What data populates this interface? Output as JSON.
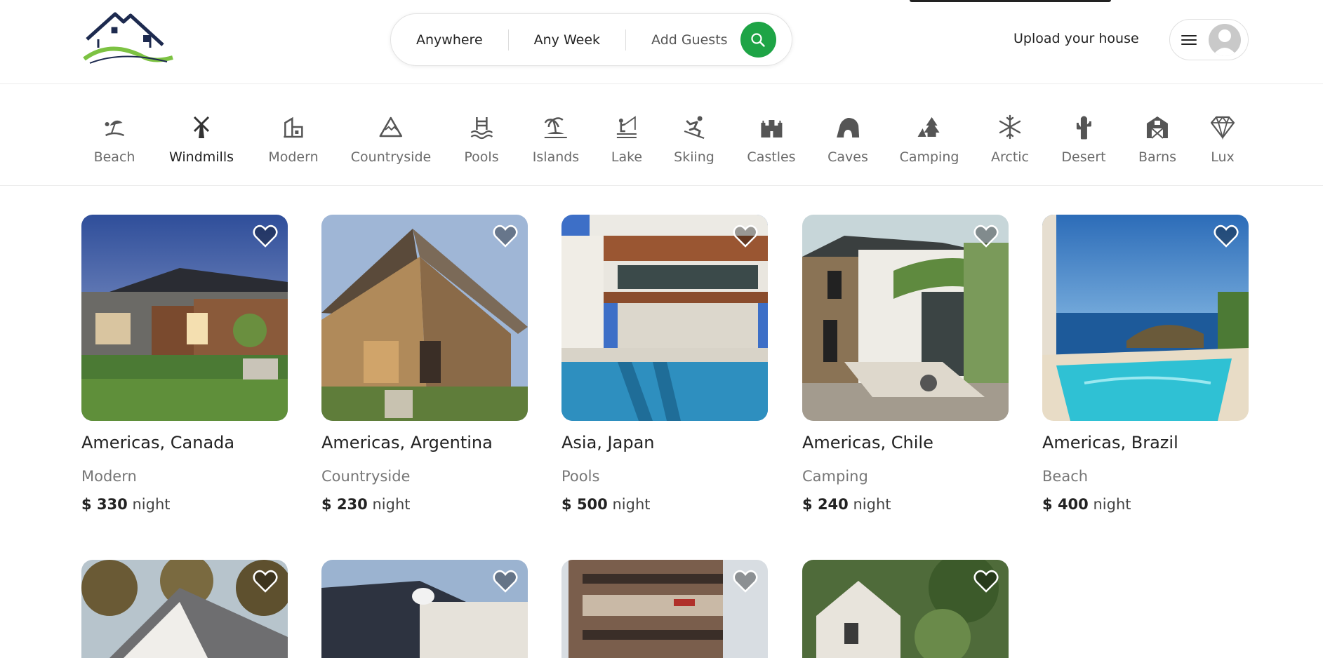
{
  "header": {
    "logo_icon": "house-logo-icon",
    "search": {
      "where": "Anywhere",
      "when": "Any Week",
      "guests": "Add Guests",
      "button_icon": "search-icon"
    },
    "upload_label": "Upload your house",
    "menu_icon": "menu-icon",
    "avatar_icon": "avatar-icon"
  },
  "categories": [
    {
      "label": "Beach",
      "icon": "beach-icon"
    },
    {
      "label": "Windmills",
      "icon": "windmill-icon"
    },
    {
      "label": "Modern",
      "icon": "modern-icon"
    },
    {
      "label": "Countryside",
      "icon": "mountain-icon"
    },
    {
      "label": "Pools",
      "icon": "pool-icon"
    },
    {
      "label": "Islands",
      "icon": "island-icon"
    },
    {
      "label": "Lake",
      "icon": "lake-icon"
    },
    {
      "label": "Skiing",
      "icon": "skiing-icon"
    },
    {
      "label": "Castles",
      "icon": "castle-icon"
    },
    {
      "label": "Caves",
      "icon": "cave-icon"
    },
    {
      "label": "Camping",
      "icon": "camping-icon"
    },
    {
      "label": "Arctic",
      "icon": "snowflake-icon"
    },
    {
      "label": "Desert",
      "icon": "cactus-icon"
    },
    {
      "label": "Barns",
      "icon": "barn-icon"
    },
    {
      "label": "Lux",
      "icon": "diamond-icon"
    }
  ],
  "listings": [
    {
      "location": "Americas, Canada",
      "category": "Modern",
      "currency": "$",
      "price": "330",
      "per": "night"
    },
    {
      "location": "Americas, Argentina",
      "category": "Countryside",
      "currency": "$",
      "price": "230",
      "per": "night"
    },
    {
      "location": "Asia, Japan",
      "category": "Pools",
      "currency": "$",
      "price": "500",
      "per": "night"
    },
    {
      "location": "Americas, Chile",
      "category": "Camping",
      "currency": "$",
      "price": "240",
      "per": "night"
    },
    {
      "location": "Americas, Brazil",
      "category": "Beach",
      "currency": "$",
      "price": "400",
      "per": "night"
    }
  ],
  "colors": {
    "accent": "#1ea446",
    "text": "#222222",
    "muted": "#777777"
  }
}
